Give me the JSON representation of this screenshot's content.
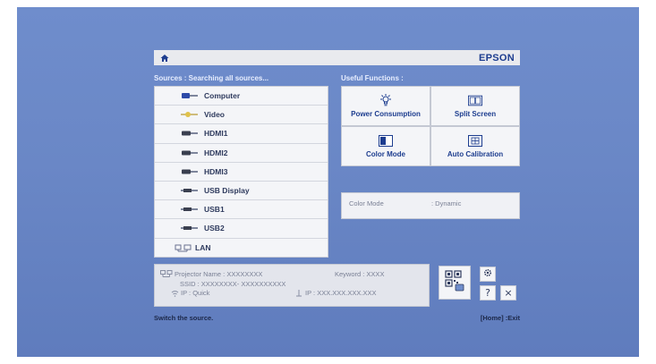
{
  "header": {
    "brand": "EPSON"
  },
  "sources": {
    "heading": "Sources : Searching all sources...",
    "items": [
      {
        "label": "Computer",
        "icon": "computer-port-icon"
      },
      {
        "label": "Video",
        "icon": "video-port-icon"
      },
      {
        "label": "HDMI1",
        "icon": "hdmi-port-icon"
      },
      {
        "label": "HDMI2",
        "icon": "hdmi-port-icon"
      },
      {
        "label": "HDMI3",
        "icon": "hdmi-port-icon"
      },
      {
        "label": "USB Display",
        "icon": "usb-port-icon"
      },
      {
        "label": "USB1",
        "icon": "usb-port-icon"
      },
      {
        "label": "USB2",
        "icon": "usb-port-icon"
      },
      {
        "label": "LAN",
        "icon": "lan-icon"
      }
    ]
  },
  "functions": {
    "heading": "Useful Functions :",
    "items": [
      {
        "label": "Power Consumption",
        "icon": "lightbulb-icon"
      },
      {
        "label": "Split Screen",
        "icon": "split-screen-icon"
      },
      {
        "label": "Color Mode",
        "icon": "color-mode-icon"
      },
      {
        "label": "Auto Calibration",
        "icon": "auto-calibration-icon"
      }
    ]
  },
  "status": {
    "key": "Color Mode",
    "value": ": Dynamic"
  },
  "network": {
    "projector_name": "Projector Name : XXXXXXXX",
    "keyword": "Keyword : XXXX",
    "ssid": "SSID : XXXXXXXX- XXXXXXXXXX",
    "ip_quick": "IP : Quick",
    "ip_wired": "IP : XXX.XXX.XXX.XXX"
  },
  "buttons": {
    "help": "?",
    "close": "×"
  },
  "footer": {
    "hint": "Switch the source.",
    "exit": "[Home] :Exit"
  },
  "colors": {
    "background": "#6a87c6",
    "brand": "#1d3d8f",
    "panel": "#f4f5f8"
  }
}
